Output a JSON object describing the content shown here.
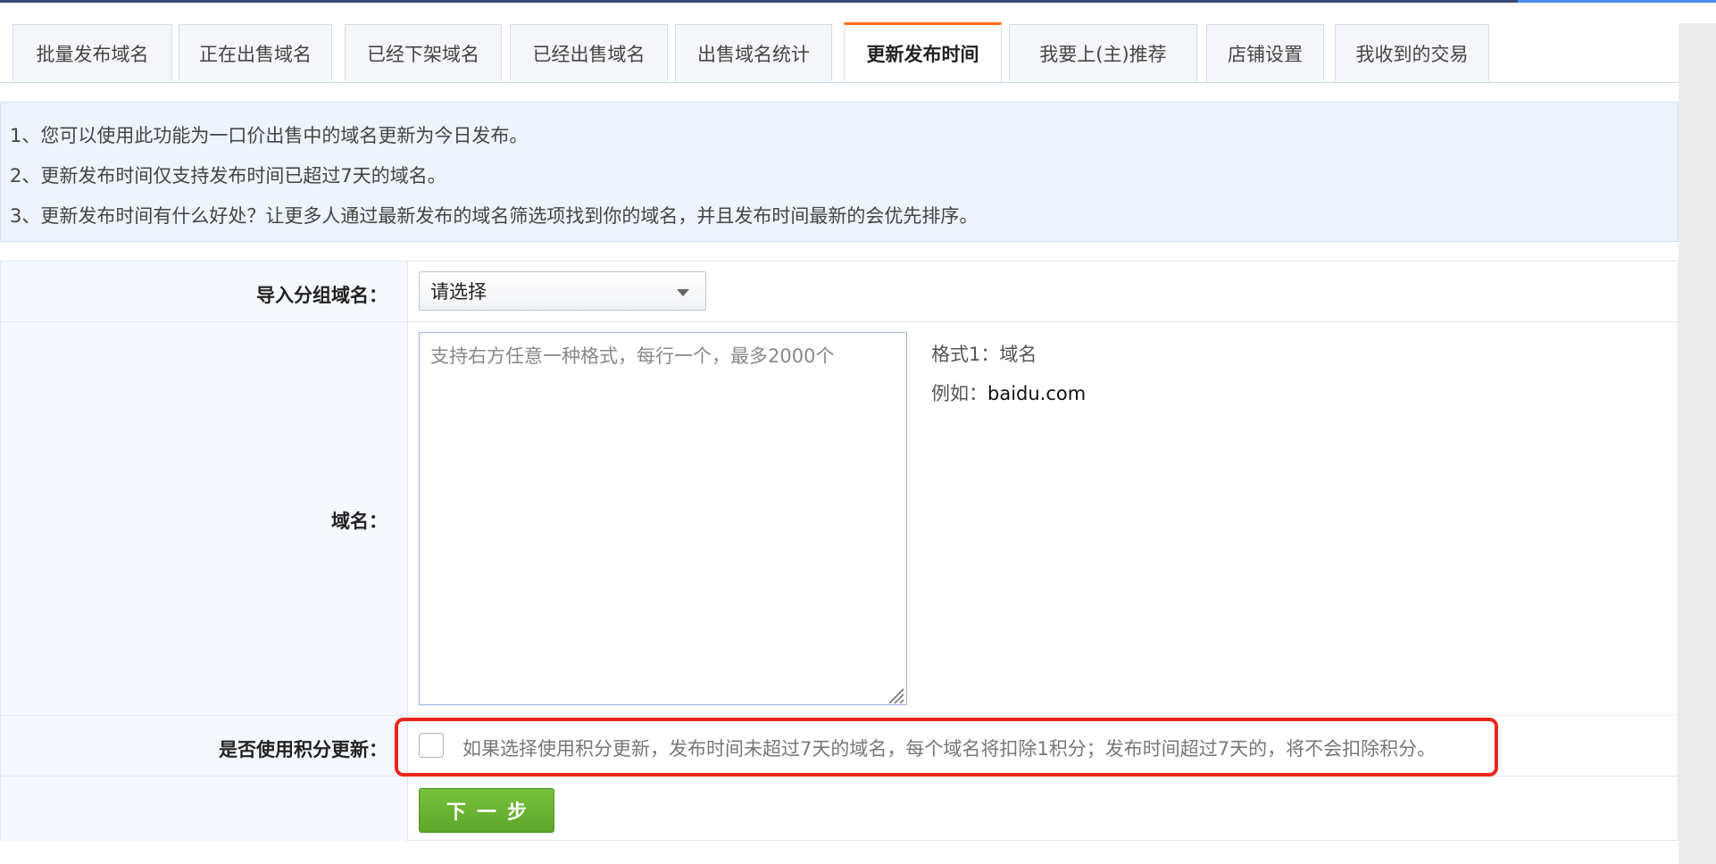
{
  "tabs": [
    {
      "label": "批量发布域名"
    },
    {
      "label": "正在出售域名"
    },
    {
      "label": "已经下架域名"
    },
    {
      "label": "已经出售域名"
    },
    {
      "label": "出售域名统计"
    },
    {
      "label": "更新发布时间",
      "active": true
    },
    {
      "label": "我要上(主)推荐"
    },
    {
      "label": "店铺设置"
    },
    {
      "label": "我收到的交易"
    }
  ],
  "notice": [
    "1、您可以使用此功能为一口价出售中的域名更新为今日发布。",
    "2、更新发布时间仅支持发布时间已超过7天的域名。",
    "3、更新发布时间有什么好处？让更多人通过最新发布的域名筛选项找到你的域名，并且发布时间最新的会优先排序。"
  ],
  "form": {
    "group_label": "导入分组域名：",
    "group_select_value": "请选择",
    "domain_label": "域名：",
    "domain_placeholder": "支持右方任意一种格式，每行一个，最多2000个",
    "format_title": "格式1：域名",
    "example_prefix": "例如：",
    "example_value": "baidu.com",
    "points_label": "是否使用积分更新：",
    "points_desc": "如果选择使用积分更新，发布时间未超过7天的域名，每个域名将扣除1积分；发布时间超过7天的，将不会扣除积分。",
    "next_button": "下一步"
  },
  "colors": {
    "active_tab_accent": "#ff6b1a",
    "highlight_border": "#e8271c",
    "next_button": "#6ab232",
    "notice_bg": "#eef4fb"
  }
}
